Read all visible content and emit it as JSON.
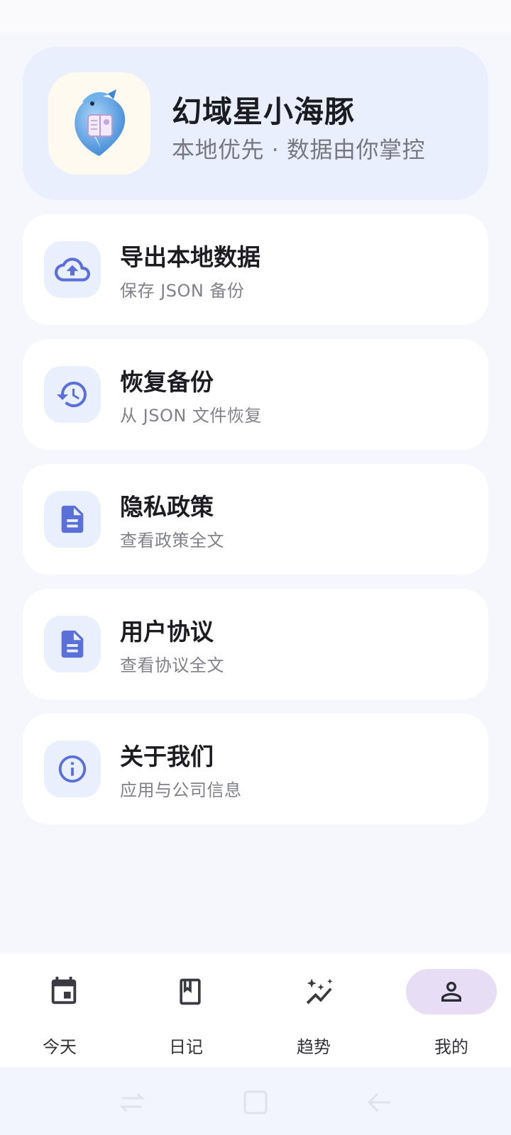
{
  "profile": {
    "app_name": "幻域星小海豚",
    "slogan": "本地优先 · 数据由你掌控",
    "avatar_icon": "dolphin-mascot-icon"
  },
  "menu": [
    {
      "title": "导出本地数据",
      "subtitle": "保存 JSON 备份",
      "icon": "cloud-upload-icon"
    },
    {
      "title": "恢复备份",
      "subtitle": "从 JSON 文件恢复",
      "icon": "history-icon"
    },
    {
      "title": "隐私政策",
      "subtitle": "查看政策全文",
      "icon": "document-icon"
    },
    {
      "title": "用户协议",
      "subtitle": "查看协议全文",
      "icon": "document-icon"
    },
    {
      "title": "关于我们",
      "subtitle": "应用与公司信息",
      "icon": "info-icon"
    }
  ],
  "bottom_nav": [
    {
      "label": "今天",
      "icon": "calendar-icon",
      "active": false
    },
    {
      "label": "日记",
      "icon": "bookmark-book-icon",
      "active": false
    },
    {
      "label": "趋势",
      "icon": "sparkle-trend-icon",
      "active": false
    },
    {
      "label": "我的",
      "icon": "person-icon",
      "active": true
    }
  ],
  "colors": {
    "accent": "#5a6fd8",
    "card_tint": "#eaeffd",
    "active_pill": "#e7def5",
    "background": "#f5f7fd"
  }
}
